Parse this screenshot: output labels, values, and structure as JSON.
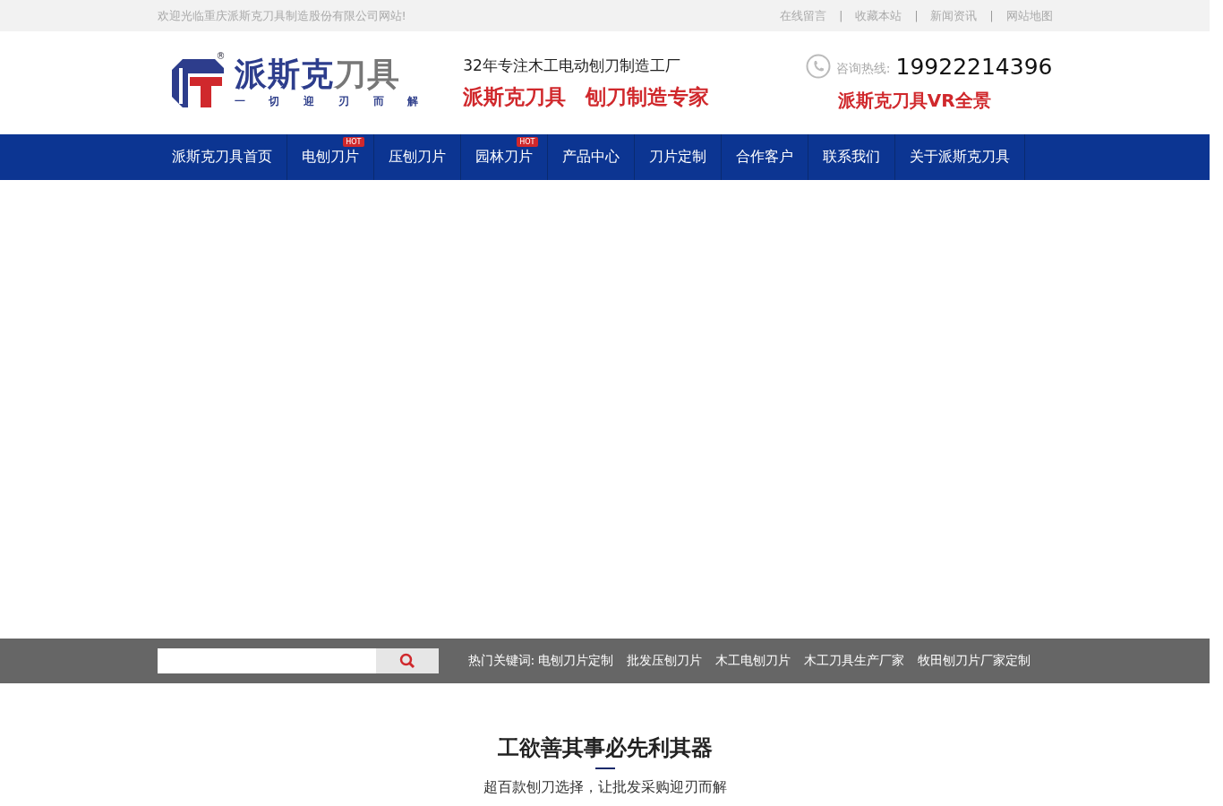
{
  "topbar": {
    "welcome": "欢迎光临重庆派斯克刀具制造股份有限公司网站!",
    "links": [
      "在线留言",
      "收藏本站",
      "新闻资讯",
      "网站地图"
    ],
    "separator": "|"
  },
  "header": {
    "logo": {
      "name_main": "派斯克",
      "name_sub": "刀具",
      "registered": "®",
      "motto": [
        "一",
        "切",
        "迎",
        "刃",
        "而",
        "解"
      ]
    },
    "slogan": "32年专注木工电动刨刀制造工厂",
    "tagline": [
      "派斯克刀具",
      "刨刀制造专家"
    ],
    "hotline_label": "咨询热线:",
    "hotline": "19922214396",
    "vr_link": "派斯克刀具VR全景"
  },
  "nav": [
    {
      "label": "派斯克刀具首页"
    },
    {
      "label": "电刨刀片",
      "badge": "HOT"
    },
    {
      "label": "压刨刀片"
    },
    {
      "label": "园林刀片",
      "badge": "HOT"
    },
    {
      "label": "产品中心"
    },
    {
      "label": "刀片定制"
    },
    {
      "label": "合作客户"
    },
    {
      "label": "联系我们"
    },
    {
      "label": "关于派斯克刀具"
    }
  ],
  "search": {
    "hot_label": "热门关键词:",
    "keywords": [
      "电刨刀片定制",
      "批发压刨刀片",
      "木工电刨刀片",
      "木工刀具生产厂家",
      "牧田刨刀片厂家定制"
    ]
  },
  "section": {
    "title": "工欲善其事必先利其器",
    "subtitle": "超百款刨刀选择，让批发采购迎刃而解"
  }
}
